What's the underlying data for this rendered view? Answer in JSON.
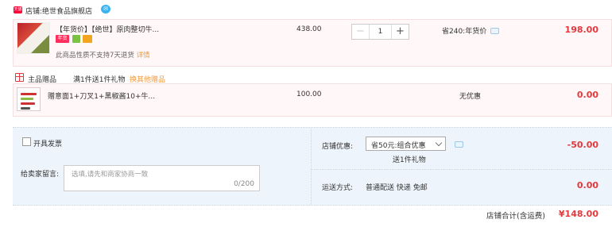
{
  "store": {
    "badge": "天猫",
    "label": "店铺:",
    "name": "绝世食品旗舰店"
  },
  "items": [
    {
      "title": "【年货价】【绝世】原肉整切牛...",
      "tags": [
        {
          "text": "年货",
          "color": "#ff2d5b"
        },
        {
          "text": "",
          "color": "#7cc242"
        },
        {
          "text": "",
          "color": "#f4a51f"
        }
      ],
      "note": "此商品性质不支持7天退货",
      "note_link": "详情",
      "unit_price": "438.00",
      "quantity": "1",
      "promo": "省240:年货价",
      "subtotal": "198.00"
    }
  ],
  "gift": {
    "header": "主品赠品",
    "desc": "满1件送1件礼物",
    "change_link": "换其他赠品",
    "title": "赠意面1+刀叉1+黑椒酱10+牛...",
    "unit_price": "100.00",
    "promo": "无优惠",
    "subtotal": "0.00"
  },
  "options": {
    "invoice_label": "开具发票",
    "message_label": "给卖家留言:",
    "message_placeholder": "选填,请先和商家协商一致",
    "message_counter": "0/200",
    "discount_label": "店铺优惠:",
    "discount_selected": "省50元:组合优惠",
    "discount_sub": "送1件礼物",
    "discount_amount": "-50.00",
    "shipping_label": "运送方式:",
    "shipping_method": "普通配送 快递 免邮",
    "shipping_amount": "0.00"
  },
  "total": {
    "label": "店铺合计(含运费)",
    "amount": "¥148.00"
  }
}
